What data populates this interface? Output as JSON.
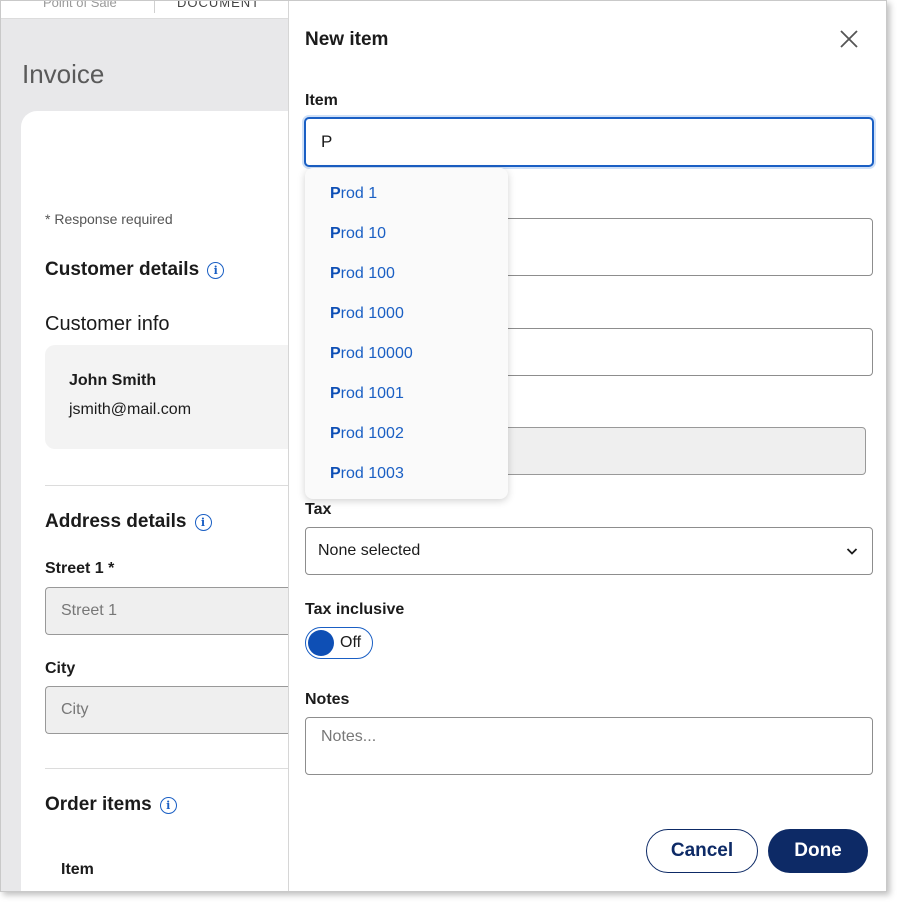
{
  "background": {
    "topbar_left": "Point of Sale",
    "topbar_right": "DOCUMENT",
    "page_title": "Invoice",
    "response_required": "* Response required",
    "customer_details": "Customer details",
    "customer_info": "Customer info",
    "customer_name": "John Smith",
    "customer_email": "jsmith@mail.com",
    "address_details": "Address details",
    "street_label": "Street 1 *",
    "street_placeholder": "Street 1",
    "city_label": "City",
    "city_placeholder": "City",
    "order_items": "Order items",
    "item_column": "Item"
  },
  "modal": {
    "title": "New item",
    "item_label": "Item",
    "item_value": "P",
    "tax_label": "Tax",
    "tax_value": "None selected",
    "tax_inclusive_label": "Tax inclusive",
    "toggle_state": "Off",
    "notes_label": "Notes",
    "notes_placeholder": "Notes...",
    "cancel_label": "Cancel",
    "done_label": "Done"
  },
  "dropdown": {
    "match": "P",
    "options": [
      {
        "rest": "rod 1"
      },
      {
        "rest": "rod 10"
      },
      {
        "rest": "rod 100"
      },
      {
        "rest": "rod 1000"
      },
      {
        "rest": "rod 10000"
      },
      {
        "rest": "rod 1001"
      },
      {
        "rest": "rod 1002"
      },
      {
        "rest": "rod 1003"
      }
    ]
  },
  "colors": {
    "accent": "#1a5fc4",
    "primary_button": "#0d2a66"
  }
}
